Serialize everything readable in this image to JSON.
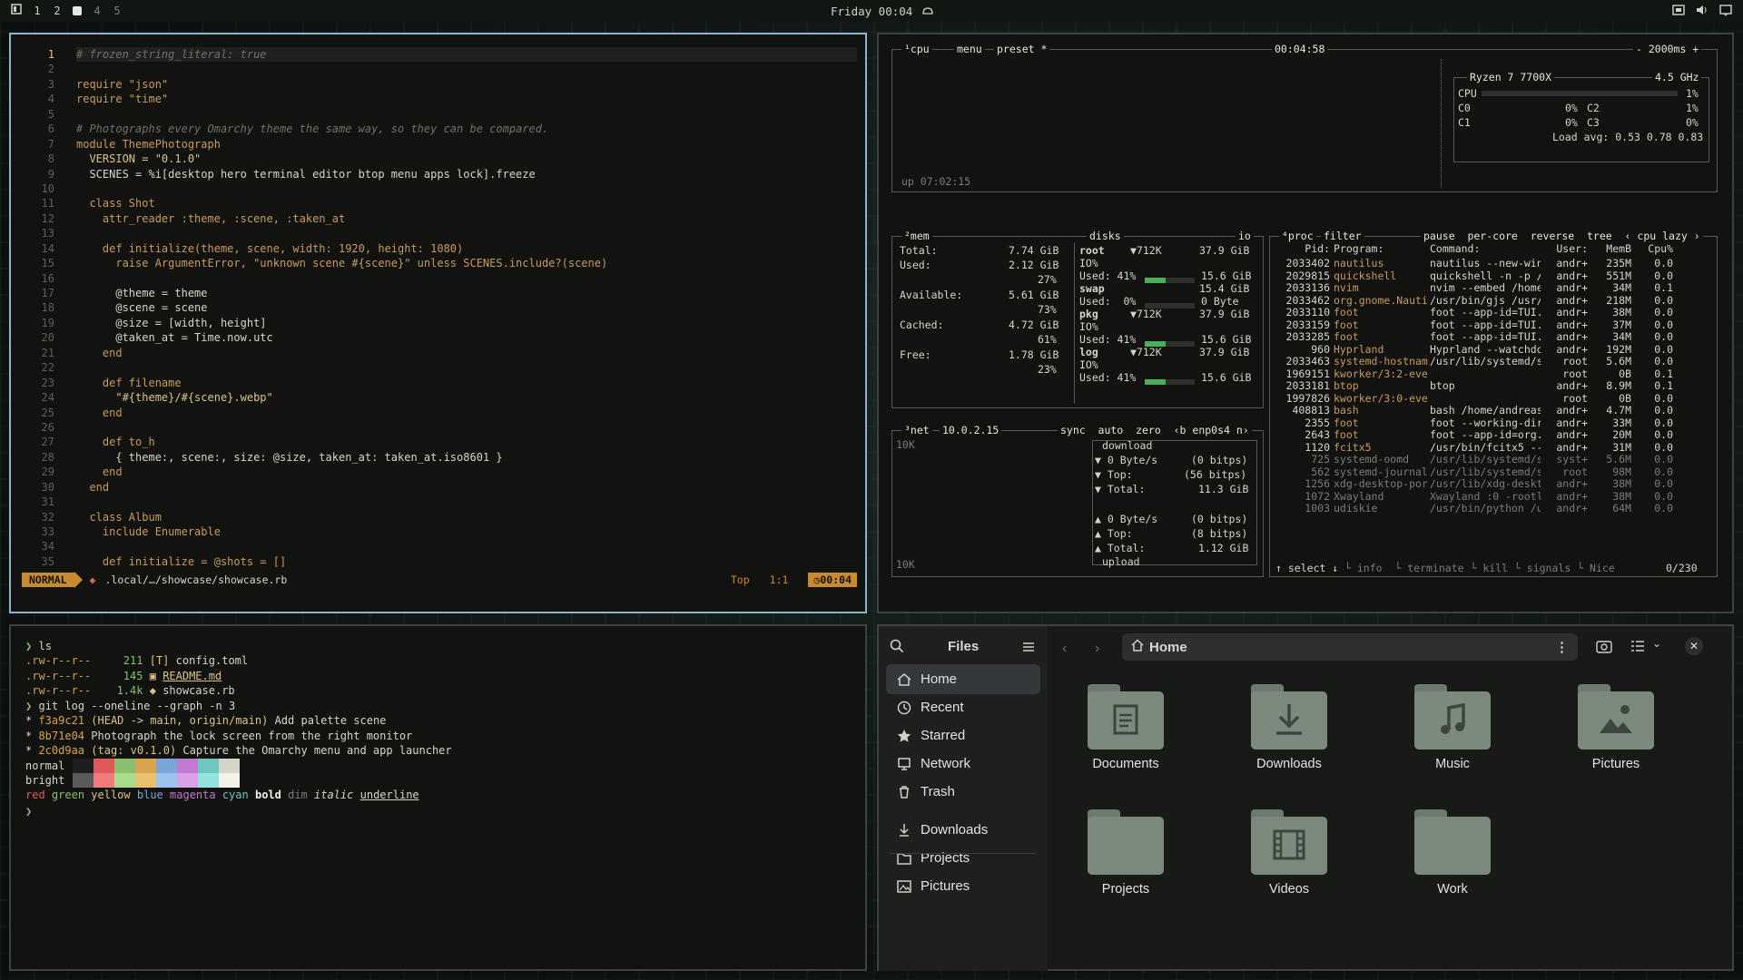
{
  "topbar": {
    "workspaces": [
      "1",
      "2",
      "3",
      "4",
      "5"
    ],
    "active_workspace": "3",
    "clock": "Friday 00:04",
    "icons": [
      "workspace-overview-icon",
      "idle-inhibit-icon",
      "screen-icon",
      "volume-icon",
      "notification-icon"
    ]
  },
  "editor": {
    "mode": "NORMAL",
    "file_path": ".local/…/showcase/showcase.rb",
    "scroll": "Top",
    "position": "1:1",
    "time": "00:04",
    "line_numbers": [
      "1",
      "2",
      "3",
      "4",
      "5",
      "6",
      "7",
      "8",
      "9",
      "10",
      "11",
      "12",
      "13",
      "14",
      "15",
      "16",
      "17",
      "18",
      "19",
      "20",
      "21",
      "22",
      "23",
      "24",
      "25",
      "26",
      "27",
      "28",
      "29",
      "30",
      "31",
      "32",
      "33",
      "34",
      "35"
    ],
    "lines": [
      "# frozen_string_literal: true",
      "",
      "require \"json\"",
      "require \"time\"",
      "",
      "# Photographs every Omarchy theme the same way, so they can be compared.",
      "module ThemePhotograph",
      "  VERSION = \"0.1.0\"",
      "  SCENES = %i[desktop hero terminal editor btop menu apps lock].freeze",
      "",
      "  class Shot",
      "    attr_reader :theme, :scene, :taken_at",
      "",
      "    def initialize(theme, scene, width: 1920, height: 1080)",
      "      raise ArgumentError, \"unknown scene #{scene}\" unless SCENES.include?(scene)",
      "",
      "      @theme = theme",
      "      @scene = scene",
      "      @size = [width, height]",
      "      @taken_at = Time.now.utc",
      "    end",
      "",
      "    def filename",
      "      \"#{theme}/#{scene}.webp\"",
      "    end",
      "",
      "    def to_h",
      "      { theme:, scene:, size: @size, taken_at: taken_at.iso8601 }",
      "    end",
      "  end",
      "",
      "  class Album",
      "    include Enumerable",
      "",
      "    def initialize = @shots = []"
    ]
  },
  "btop": {
    "cpu": {
      "title": "¹cpu",
      "menu": "menu",
      "preset": "preset *",
      "clock": "00:04:58",
      "interval": "- 2000ms +",
      "model": "Ryzen 7 7700X",
      "freq": "4.5 GHz",
      "cpu_label": "CPU",
      "cpu_pct": "1%",
      "cores": [
        {
          "name": "C0",
          "pct": "0%"
        },
        {
          "name": "C2",
          "pct": "1%"
        },
        {
          "name": "C1",
          "pct": "0%"
        },
        {
          "name": "C3",
          "pct": "0%"
        }
      ],
      "load_avg": "Load avg: 0.53 0.78 0.83",
      "uptime": "up 07:02:15"
    },
    "mem": {
      "title": "²mem",
      "total_label": "Total:",
      "total": "7.74 GiB",
      "used_label": "Used:",
      "used": "2.12 GiB",
      "used_pct": "27%",
      "avail_label": "Available:",
      "avail": "5.61 GiB",
      "avail_pct": "73%",
      "cached_label": "Cached:",
      "cached": "4.72 GiB",
      "cached_pct": "61%",
      "free_label": "Free:",
      "free": "1.78 GiB",
      "free_pct": "23%"
    },
    "disks": {
      "title": "disks",
      "io": "io",
      "items": [
        {
          "name": "root",
          "io": "▼712K",
          "size": "37.9 GiB",
          "io_label": "IO%",
          "used_label": "Used: 41%",
          "used": "15.6 GiB",
          "fill": 0.41
        },
        {
          "name": "swap",
          "io": "",
          "size": "15.4 GiB",
          "io_label": "",
          "used_label": "Used:  0%",
          "used": "0 Byte",
          "fill": 0.0
        },
        {
          "name": "pkg",
          "io": "▼712K",
          "size": "37.9 GiB",
          "io_label": "IO%",
          "used_label": "Used: 41%",
          "used": "15.6 GiB",
          "fill": 0.41
        },
        {
          "name": "log",
          "io": "▼712K",
          "size": "37.9 GiB",
          "io_label": "IO%",
          "used_label": "Used: 41%",
          "used": "15.6 GiB",
          "fill": 0.41
        }
      ]
    },
    "net": {
      "title": "³net",
      "ip": "10.0.2.15",
      "controls": "sync  auto  zero  ‹b enp0s4 n›",
      "scale_top": "10K",
      "scale_bottom": "10K",
      "download": "download",
      "dl_rate": "▼ 0 Byte/s",
      "dl_rate_bits": "(0 bitps)",
      "dl_top": "▼ Top:",
      "dl_top_bits": "(56 bitps)",
      "dl_total": "▼ Total:",
      "dl_total_val": "11.3 GiB",
      "ul_rate": "▲ 0 Byte/s",
      "ul_rate_bits": "(0 bitps)",
      "ul_top": "▲ Top:",
      "ul_top_bits": "(8 bitps)",
      "ul_total": "▲ Total:",
      "ul_total_val": "1.12 GiB",
      "upload": "upload"
    },
    "proc": {
      "title": "⁴proc",
      "filter": "filter",
      "controls": "pause  per-core  reverse  tree  ‹ cpu lazy ›",
      "headers": [
        "Pid:",
        "Program:",
        "Command:",
        "User:",
        "MemB",
        "Cpu%"
      ],
      "rows": [
        [
          "2033402",
          "nautilus",
          "nautilus --new-win",
          "andr+",
          "235M",
          "0.0"
        ],
        [
          "2029815",
          "quickshell",
          "quickshell -n -p /",
          "andr+",
          "551M",
          "0.0"
        ],
        [
          "2033136",
          "nvim",
          "nvim --embed /home",
          "andr+",
          "34M",
          "0.1"
        ],
        [
          "2033462",
          "org.gnome.Nauti",
          "/usr/bin/gjs /usr/",
          "andr+",
          "218M",
          "0.0"
        ],
        [
          "2033110",
          "foot",
          "foot --app-id=TUI.",
          "andr+",
          "38M",
          "0.0"
        ],
        [
          "2033159",
          "foot",
          "foot --app-id=TUI.",
          "andr+",
          "37M",
          "0.0"
        ],
        [
          "2033285",
          "foot",
          "foot --app-id=TUI.",
          "andr+",
          "34M",
          "0.0"
        ],
        [
          "960",
          "Hyprland",
          "Hyprland --watchdo",
          "andr+",
          "192M",
          "0.0"
        ],
        [
          "2033463",
          "systemd-hostnam",
          "/usr/lib/systemd/s",
          "root",
          "5.6M",
          "0.0"
        ],
        [
          "1969151",
          "kworker/3:2-even",
          "",
          "root",
          "0B",
          "0.1"
        ],
        [
          "2033181",
          "btop",
          "btop",
          "andr+",
          "8.9M",
          "0.1"
        ],
        [
          "1997826",
          "kworker/3:0-even",
          "",
          "root",
          "0B",
          "0.0"
        ],
        [
          "408813",
          "bash",
          "bash /home/andreas",
          "andr+",
          "4.7M",
          "0.0"
        ],
        [
          "2355",
          "foot",
          "foot --working-dir",
          "andr+",
          "33M",
          "0.0"
        ],
        [
          "2643",
          "foot",
          "foot --app-id=org.",
          "andr+",
          "20M",
          "0.0"
        ],
        [
          "1120",
          "fcitx5",
          "/usr/bin/fcitx5 --",
          "andr+",
          "31M",
          "0.0"
        ],
        [
          "725",
          "systemd-oomd",
          "/usr/lib/systemd/s",
          "syst+",
          "5.6M",
          "0.0"
        ],
        [
          "562",
          "systemd-journal",
          "/usr/lib/systemd/s",
          "root",
          "98M",
          "0.0"
        ],
        [
          "1256",
          "xdg-desktop-por",
          "/usr/lib/xdg-deskt",
          "andr+",
          "38M",
          "0.0"
        ],
        [
          "1072",
          "Xwayland",
          "Xwayland :0 -rootl",
          "andr+",
          "38M",
          "0.0"
        ],
        [
          "1003",
          "udiskie",
          "/usr/bin/python /u",
          "andr+",
          "64M",
          "0.0"
        ]
      ],
      "footer_select": "↑ select ↓",
      "footer_rest": "└ info  └ terminate └ kill └ signals └ Nice",
      "count": "0/230"
    }
  },
  "terminal": {
    "prompt": "❯",
    "cmd1": "ls",
    "files": [
      {
        "perm": ".rw-r--r--",
        "size": "211",
        "icon": "[T]",
        "name": "config.toml"
      },
      {
        "perm": ".rw-r--r--",
        "size": "145",
        "icon": "▣",
        "name": "README.md"
      },
      {
        "perm": ".rw-r--r--",
        "size": "1.4k",
        "icon": "◆",
        "name": "showcase.rb"
      }
    ],
    "cmd2": "git log --oneline --graph -n 3",
    "commits": [
      {
        "hash": "f3a9c21",
        "ref": "(HEAD -> main, origin/main)",
        "msg": "Add palette scene"
      },
      {
        "hash": "8b71e04",
        "ref": "",
        "msg": "Photograph the lock screen from the right monitor"
      },
      {
        "hash": "2c0d9aa",
        "ref": "(tag: v0.1.0)",
        "msg": "Capture the Omarchy menu and app launcher"
      }
    ],
    "palette_normal_label": "normal",
    "palette_bright_label": "bright",
    "palette_normal": [
      "#1e1e1e",
      "#e0595a",
      "#88c070",
      "#d9a54c",
      "#7aa5d8",
      "#c07ad0",
      "#6fc6c0",
      "#d6d6c8"
    ],
    "palette_bright": [
      "#5a5a5a",
      "#ef7b7b",
      "#a6dc8c",
      "#e9c070",
      "#9cc2ee",
      "#d8a2e6",
      "#93e2dc",
      "#f2f2ea"
    ],
    "styles": [
      "red",
      "green",
      "yellow",
      "blue",
      "magenta",
      "cyan",
      "bold",
      "dim",
      "italic",
      "underline"
    ]
  },
  "files": {
    "title": "Files",
    "location": "Home",
    "sidebar": [
      {
        "label": "Home",
        "icon": "home-icon"
      },
      {
        "label": "Recent",
        "icon": "clock-icon"
      },
      {
        "label": "Starred",
        "icon": "star-icon"
      },
      {
        "label": "Network",
        "icon": "network-icon"
      },
      {
        "label": "Trash",
        "icon": "trash-icon"
      },
      {
        "label": "Downloads",
        "icon": "download-icon"
      },
      {
        "label": "Projects",
        "icon": "folder-icon"
      },
      {
        "label": "Pictures",
        "icon": "image-icon"
      }
    ],
    "folders": [
      "Documents",
      "Downloads",
      "Music",
      "Pictures",
      "Projects",
      "Videos",
      "Work"
    ]
  }
}
